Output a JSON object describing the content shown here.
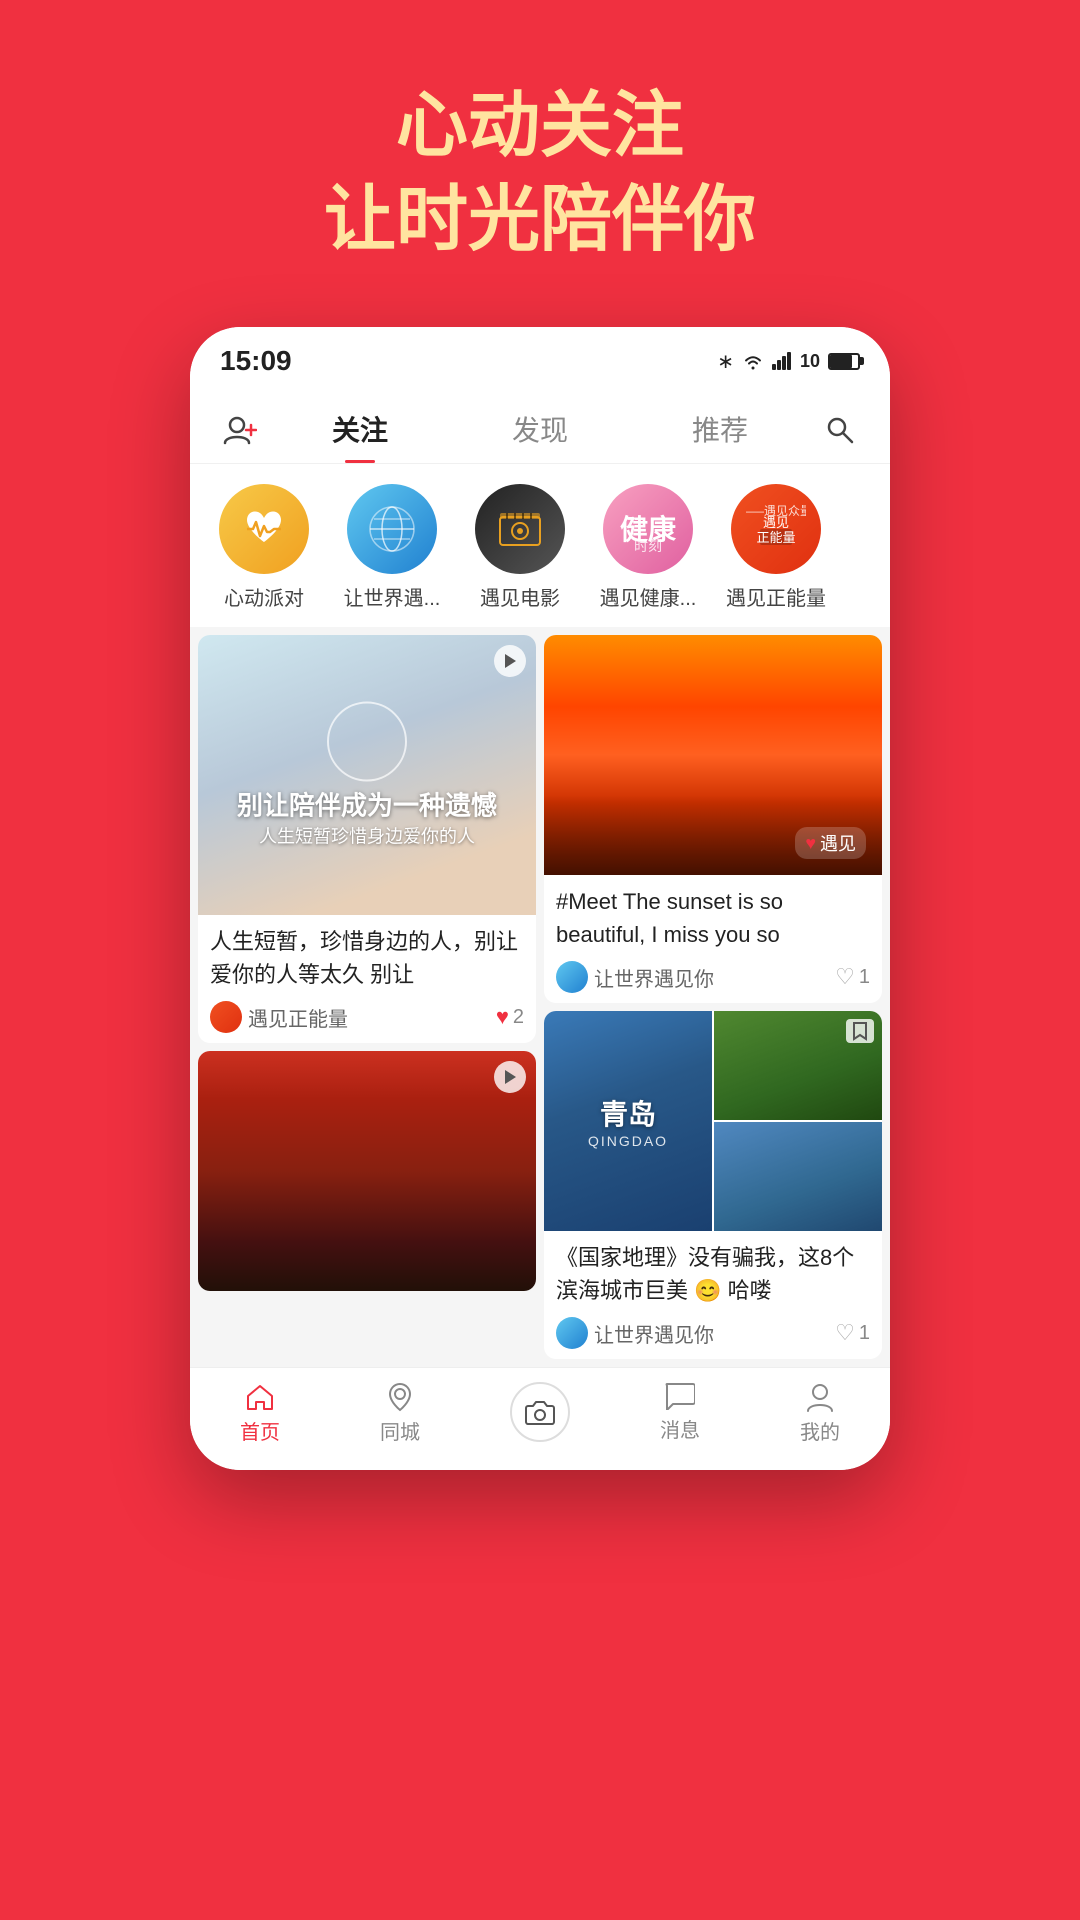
{
  "background_color": "#f03040",
  "tagline": {
    "line1": "心动关注",
    "line2": "让时光陪伴你"
  },
  "status_bar": {
    "time": "15:09",
    "signal_icon": "📶",
    "battery_label": "10"
  },
  "nav": {
    "follow_icon_label": "follow-people-icon",
    "tabs": [
      "关注",
      "发现",
      "推荐"
    ],
    "active_tab": "关注",
    "search_icon_label": "search-icon"
  },
  "stories": [
    {
      "label": "心动派对",
      "circle_class": "circle-heartbeat"
    },
    {
      "label": "让世界遇...",
      "circle_class": "circle-world"
    },
    {
      "label": "遇见电影",
      "circle_class": "circle-movie"
    },
    {
      "label": "遇见健康...",
      "circle_class": "circle-health"
    },
    {
      "label": "遇见正能量",
      "circle_class": "circle-positive"
    }
  ],
  "posts": {
    "left_col": [
      {
        "id": "post-child-video",
        "has_video": true,
        "has_overlay": true,
        "overlay_main": "别让陪伴成为一种遗憾",
        "overlay_sub": "人生短暂珍惜身边爱你的人",
        "title": "人生短暂，珍惜身边的人，别让爱你的人等太久 别让",
        "author": "遇见正能量",
        "likes": "2",
        "like_filled": true
      },
      {
        "id": "post-reeds",
        "has_video": true,
        "title": "",
        "author": "",
        "likes": ""
      }
    ],
    "right_col": [
      {
        "id": "post-sunset",
        "has_video": false,
        "title": "#Meet The sunset is so beautiful, I miss you so",
        "author": "让世界遇见你",
        "likes": "1",
        "like_filled": false
      },
      {
        "id": "post-qingdao",
        "has_video": false,
        "is_collage": true,
        "qingdao_cn": "青岛",
        "qingdao_en": "QINGDAO",
        "title": "《国家地理》没有骗我，这8个滨海城市巨美 😊 哈喽",
        "author": "让世界遇见你",
        "likes": "1",
        "like_filled": false
      }
    ]
  },
  "bottom_nav": {
    "items": [
      {
        "label": "首页",
        "active": true
      },
      {
        "label": "同城",
        "active": false
      },
      {
        "label": "",
        "active": false,
        "is_camera": true
      },
      {
        "label": "消息",
        "active": false
      },
      {
        "label": "我的",
        "active": false
      }
    ]
  }
}
